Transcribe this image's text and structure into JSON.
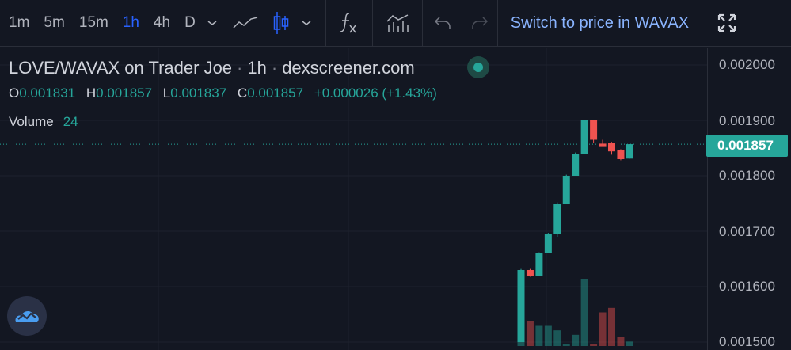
{
  "toolbar": {
    "timeframes": [
      {
        "label": "1m",
        "active": false
      },
      {
        "label": "5m",
        "active": false
      },
      {
        "label": "15m",
        "active": false
      },
      {
        "label": "1h",
        "active": true
      },
      {
        "label": "4h",
        "active": false
      },
      {
        "label": "D",
        "active": false
      }
    ],
    "switch_label": "Switch to price in WAVAX"
  },
  "legend": {
    "pair": "LOVE/WAVAX on Trader Joe",
    "interval": "1h",
    "source": "dexscreener.com",
    "o_key": "O",
    "o_val": "0.001831",
    "h_key": "H",
    "h_val": "0.001857",
    "l_key": "L",
    "l_val": "0.001837",
    "c_key": "C",
    "c_val": "0.001857",
    "change": "+0.000026 (+1.43%)",
    "volume_key": "Volume",
    "volume_val": "24"
  },
  "axis": {
    "labels": [
      "0.002000",
      "0.001900",
      "0.001800",
      "0.001700",
      "0.001600",
      "0.001500"
    ],
    "last_price": "0.001857"
  },
  "colors": {
    "bg": "#131722",
    "up": "#26a69a",
    "down": "#ef5350",
    "active_timeframe": "#2962ff",
    "switch_link": "#8ab4ff"
  },
  "chart_data": {
    "type": "candlestick",
    "ylim": [
      0.0015,
      0.002
    ],
    "candles": [
      {
        "o": 0.0015,
        "h": 0.001632,
        "l": 0.0015,
        "c": 0.00163,
        "vol": 0.6
      },
      {
        "o": 0.00163,
        "h": 0.001632,
        "l": 0.001618,
        "c": 0.00162,
        "vol": 0.22
      },
      {
        "o": 0.00162,
        "h": 0.001662,
        "l": 0.00162,
        "c": 0.00166,
        "vol": 0.18
      },
      {
        "o": 0.00166,
        "h": 0.001697,
        "l": 0.00166,
        "c": 0.001695,
        "vol": 0.18
      },
      {
        "o": 0.001695,
        "h": 0.001752,
        "l": 0.00169,
        "c": 0.00175,
        "vol": 0.14
      },
      {
        "o": 0.00175,
        "h": 0.001802,
        "l": 0.00175,
        "c": 0.0018,
        "vol": 0.02
      },
      {
        "o": 0.0018,
        "h": 0.001842,
        "l": 0.0018,
        "c": 0.00184,
        "vol": 0.1
      },
      {
        "o": 0.00184,
        "h": 0.0019,
        "l": 0.00184,
        "c": 0.0019,
        "vol": 0.6
      },
      {
        "o": 0.0019,
        "h": 0.0019,
        "l": 0.00186,
        "c": 0.001865,
        "vol": 0.02
      },
      {
        "o": 0.001858,
        "h": 0.001865,
        "l": 0.001856,
        "c": 0.001852,
        "vol": 0.3
      },
      {
        "o": 0.001859,
        "h": 0.001861,
        "l": 0.001838,
        "c": 0.001844,
        "vol": 0.34
      },
      {
        "o": 0.001846,
        "h": 0.001848,
        "l": 0.001828,
        "c": 0.00183,
        "vol": 0.08
      },
      {
        "o": 0.001831,
        "h": 0.001857,
        "l": 0.001831,
        "c": 0.001857,
        "vol": 0.04
      }
    ]
  }
}
